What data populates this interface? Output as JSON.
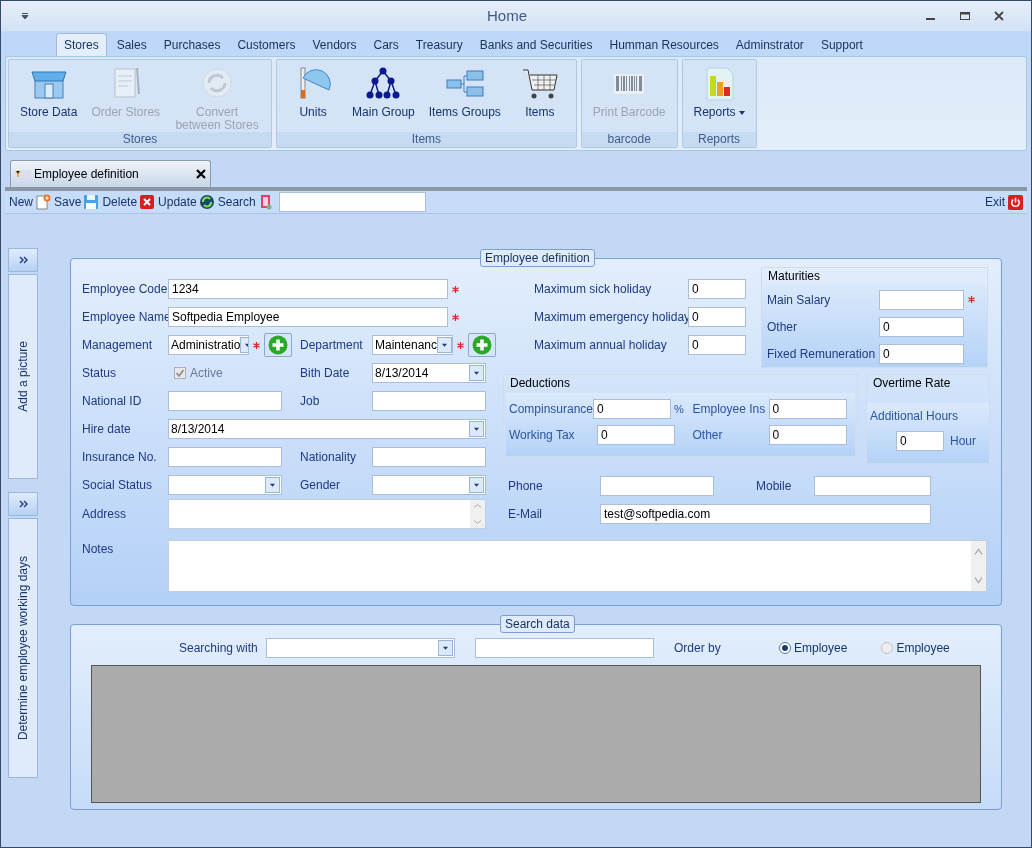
{
  "window": {
    "title": "Home"
  },
  "ribbon_tabs": [
    {
      "label": "Stores",
      "selected": true
    },
    {
      "label": "Sales",
      "selected": false
    },
    {
      "label": "Purchases",
      "selected": false
    },
    {
      "label": "Customers",
      "selected": false
    },
    {
      "label": "Vendors",
      "selected": false
    },
    {
      "label": "Cars",
      "selected": false
    },
    {
      "label": "Treasury",
      "selected": false
    },
    {
      "label": "Banks and Securities",
      "selected": false
    },
    {
      "label": "Humman Resources",
      "selected": false
    },
    {
      "label": "Adminstrator",
      "selected": false
    },
    {
      "label": "Support",
      "selected": false
    }
  ],
  "ribbon_groups": [
    {
      "title": "Stores",
      "buttons": [
        {
          "label": "Store Data",
          "kind": "store",
          "disabled": false,
          "dropdown": false
        },
        {
          "label": "Order Stores",
          "kind": "order",
          "disabled": true,
          "dropdown": false
        },
        {
          "label": "Convert between Stores",
          "kind": "convert",
          "disabled": true,
          "dropdown": false
        }
      ]
    },
    {
      "title": "Items",
      "buttons": [
        {
          "label": "Units",
          "kind": "units",
          "disabled": false,
          "dropdown": false
        },
        {
          "label": "Main Group",
          "kind": "tree",
          "disabled": false,
          "dropdown": false
        },
        {
          "label": "Items Groups",
          "kind": "groups",
          "disabled": false,
          "dropdown": false
        },
        {
          "label": "Items",
          "kind": "cart",
          "disabled": false,
          "dropdown": false
        }
      ]
    },
    {
      "title": "barcode",
      "buttons": [
        {
          "label": "Print Barcode",
          "kind": "barcode",
          "disabled": true,
          "dropdown": false
        }
      ]
    },
    {
      "title": "Reports",
      "buttons": [
        {
          "label": "Reports",
          "kind": "chart",
          "disabled": false,
          "dropdown": true
        }
      ]
    }
  ],
  "document_tab": {
    "title": "Employee definition"
  },
  "toolbar": {
    "buttons": [
      {
        "label": "New",
        "kind": "new"
      },
      {
        "label": "Save",
        "kind": "save"
      },
      {
        "label": "Delete",
        "kind": "delete"
      },
      {
        "label": "Update",
        "kind": "update"
      },
      {
        "label": "Search",
        "kind": "report"
      }
    ],
    "exit": "Exit"
  },
  "side_panels": [
    {
      "label": "Add a picture"
    },
    {
      "label": "Determine employee working days"
    }
  ],
  "employee_form": {
    "title": "Employee definition",
    "rows": [
      {
        "fields": [
          {
            "label": "Employee Code",
            "kind": "text",
            "value": "1234",
            "required": true
          }
        ]
      },
      {
        "fields": [
          {
            "label": "Employee Name",
            "kind": "text",
            "value": "Softpedia Employee",
            "required": true
          }
        ]
      },
      {
        "fields": [
          {
            "label": "Management",
            "kind": "combo",
            "value": "Administratio",
            "required": true,
            "add": true
          },
          {
            "label": "Department",
            "kind": "combo",
            "value": "Maintenanc",
            "required": true,
            "add": true
          }
        ]
      },
      {
        "fields": [
          {
            "label": "Status",
            "kind": "check",
            "text": "Active",
            "checked": true,
            "disabled": true,
            "required": false
          },
          {
            "label": "Bith Date",
            "kind": "date",
            "value": "8/13/2014",
            "required": false
          }
        ]
      },
      {
        "fields": [
          {
            "label": "National ID",
            "kind": "text",
            "required": false
          },
          {
            "label": "Job",
            "kind": "text",
            "required": false
          }
        ]
      },
      {
        "fields": [
          {
            "label": "Hire date",
            "kind": "date",
            "value": "8/13/2014",
            "required": false
          }
        ]
      },
      {
        "fields": [
          {
            "label": "Insurance No.",
            "kind": "text",
            "required": false
          },
          {
            "label": "Nationality",
            "kind": "text",
            "required": false
          }
        ]
      },
      {
        "fields": [
          {
            "label": "Social Status",
            "kind": "combo",
            "required": false,
            "add": false
          },
          {
            "label": "Gender",
            "kind": "combo",
            "required": false,
            "add": false
          }
        ]
      },
      {
        "fields": [
          {
            "label": "Address",
            "kind": "memo",
            "required": false
          }
        ]
      }
    ],
    "holidays": [
      {
        "label": "Maximum sick holiday",
        "value": "0"
      },
      {
        "label": "Maximum emergency holiday",
        "value": "0"
      },
      {
        "label": "Maximum annual holiday",
        "value": "0"
      }
    ],
    "maturities": {
      "title": "Maturities",
      "fields": [
        {
          "label": "Main Salary",
          "required": true
        },
        {
          "label": "Other",
          "value": "0",
          "required": false
        },
        {
          "label": "Fixed Remuneration",
          "value": "0",
          "required": false
        }
      ]
    },
    "deductions": {
      "title": "Deductions",
      "fields": [
        {
          "label": "Compinsurance",
          "value": "0",
          "unit": "%"
        },
        {
          "label": "Employee Ins",
          "value": "0"
        },
        {
          "label": "Working Tax",
          "value": "0"
        },
        {
          "label": "Other",
          "value": "0"
        }
      ]
    },
    "overtime": {
      "title": "Overtime Rate",
      "label": "Additional Hours",
      "value": "0",
      "unit": "Hour"
    },
    "contacts": [
      {
        "label": "Phone"
      },
      {
        "label": "Mobile"
      }
    ],
    "email": {
      "label": "E-Mail",
      "value": "test@softpedia.com"
    },
    "notes": {
      "label": "Notes"
    }
  },
  "search_panel": {
    "title": "Search data",
    "searching_with": "Searching with",
    "order_by": "Order by",
    "order_options": [
      {
        "label": "Employee",
        "selected": true,
        "disabled": false
      },
      {
        "label": "Employee",
        "selected": false,
        "disabled": true
      }
    ]
  }
}
